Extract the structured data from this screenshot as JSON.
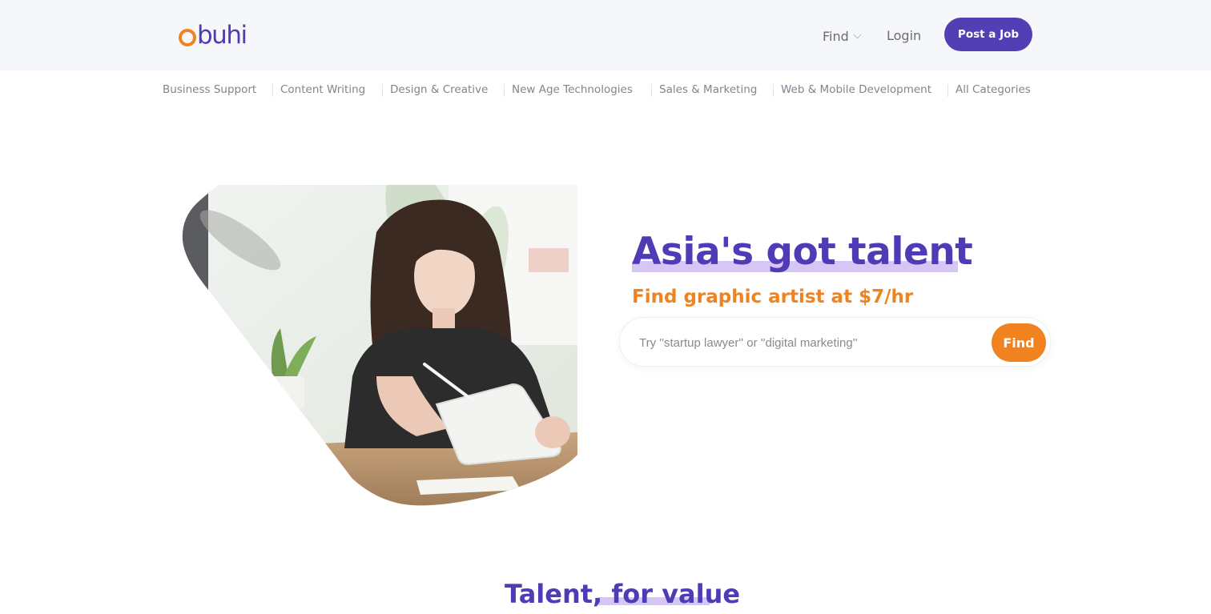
{
  "header": {
    "logo_text": "buhi",
    "nav": {
      "find_label": "Find",
      "login_label": "Login",
      "post_job_label": "Post a Job"
    }
  },
  "categories": [
    {
      "label": "Business Support"
    },
    {
      "label": "Content Writing"
    },
    {
      "label": "Design & Creative"
    },
    {
      "label": "New Age Technologies"
    },
    {
      "label": "Sales & Marketing"
    },
    {
      "label": "Web & Mobile Development"
    },
    {
      "label": "All Categories"
    }
  ],
  "hero": {
    "title": "Asia's got talent",
    "subtitle_prefix": "Find",
    "subtitle_rest": "graphic artist at $7/hr",
    "search_placeholder": "Try ''startup lawyer'' or ''digital marketing''",
    "search_button": "Find"
  },
  "section": {
    "title_strong": "Talent",
    "title_sep": ",",
    "title_rest": "for value"
  },
  "colors": {
    "brand_purple": "#4f3bb5",
    "brand_orange": "#f0831f",
    "highlight": "#d6c6f6",
    "header_bg": "#f6f7fb"
  },
  "icons": {
    "find_dropdown": "chevron-down-icon"
  }
}
